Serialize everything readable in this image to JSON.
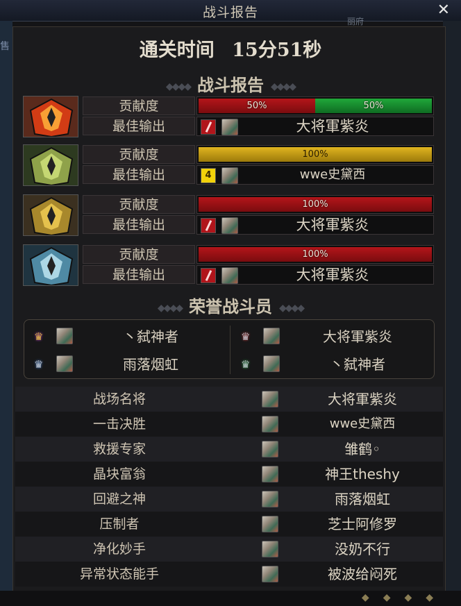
{
  "window": {
    "title": "战斗报告",
    "close_label": "✕"
  },
  "background": {
    "left_text": "售",
    "topright_text": "丽府"
  },
  "clear_time": {
    "label": "通关时间",
    "value": "15分51秒"
  },
  "report_title": "战斗报告",
  "labels": {
    "contribution": "贡献度",
    "best_output": "最佳输出"
  },
  "bosses": [
    {
      "portrait": "red-flame-boss-portrait",
      "contribution": [
        {
          "color": "red",
          "value": 50,
          "text": "50%"
        },
        {
          "color": "green",
          "value": 50,
          "text": "50%"
        }
      ],
      "best_icon": "red",
      "best_icon_text": "",
      "best_name": "大将軍紫炎"
    },
    {
      "portrait": "green-thorn-boss-portrait",
      "contribution": [
        {
          "color": "gold",
          "value": 100,
          "text": "100%"
        }
      ],
      "best_icon": "yellow",
      "best_icon_text": "4",
      "best_name": "wwe史黛西"
    },
    {
      "portrait": "gold-armor-boss-portrait",
      "contribution": [
        {
          "color": "red",
          "value": 100,
          "text": "100%"
        }
      ],
      "best_icon": "red",
      "best_icon_text": "",
      "best_name": "大将軍紫炎"
    },
    {
      "portrait": "blue-armor-boss-portrait",
      "contribution": [
        {
          "color": "red",
          "value": 100,
          "text": "100%"
        }
      ],
      "best_icon": "red",
      "best_icon_text": "",
      "best_name": "大将軍紫炎"
    }
  ],
  "honor_title": "荣誉战斗员",
  "honor_fighters": [
    {
      "medal": "gold",
      "gem": "purple",
      "name": "丶弑神者"
    },
    {
      "medal": "silver",
      "gem": "red",
      "name": "大将軍紫炎"
    },
    {
      "medal": "silver",
      "gem": "blue",
      "name": "雨落烟虹"
    },
    {
      "medal": "silver",
      "gem": "green",
      "name": "丶弑神者"
    }
  ],
  "awards": [
    {
      "title": "战场名将",
      "name": "大将軍紫炎"
    },
    {
      "title": "一击决胜",
      "name": "wwe史黛西"
    },
    {
      "title": "救援专家",
      "name": "雏鹤◦"
    },
    {
      "title": "晶块富翁",
      "name": "神王theshy"
    },
    {
      "title": "回避之神",
      "name": "雨落烟虹"
    },
    {
      "title": "压制者",
      "name": "芝士阿修罗"
    },
    {
      "title": "净化妙手",
      "name": "没奶不行"
    },
    {
      "title": "异常状态能手",
      "name": "被波给闷死"
    }
  ],
  "colors": {
    "red_bar": "#b4151a",
    "green_bar": "#20a83a",
    "gold_bar": "#e0b41f",
    "panel_bg": "#1b1b1d",
    "text": "#d9d0bf"
  }
}
